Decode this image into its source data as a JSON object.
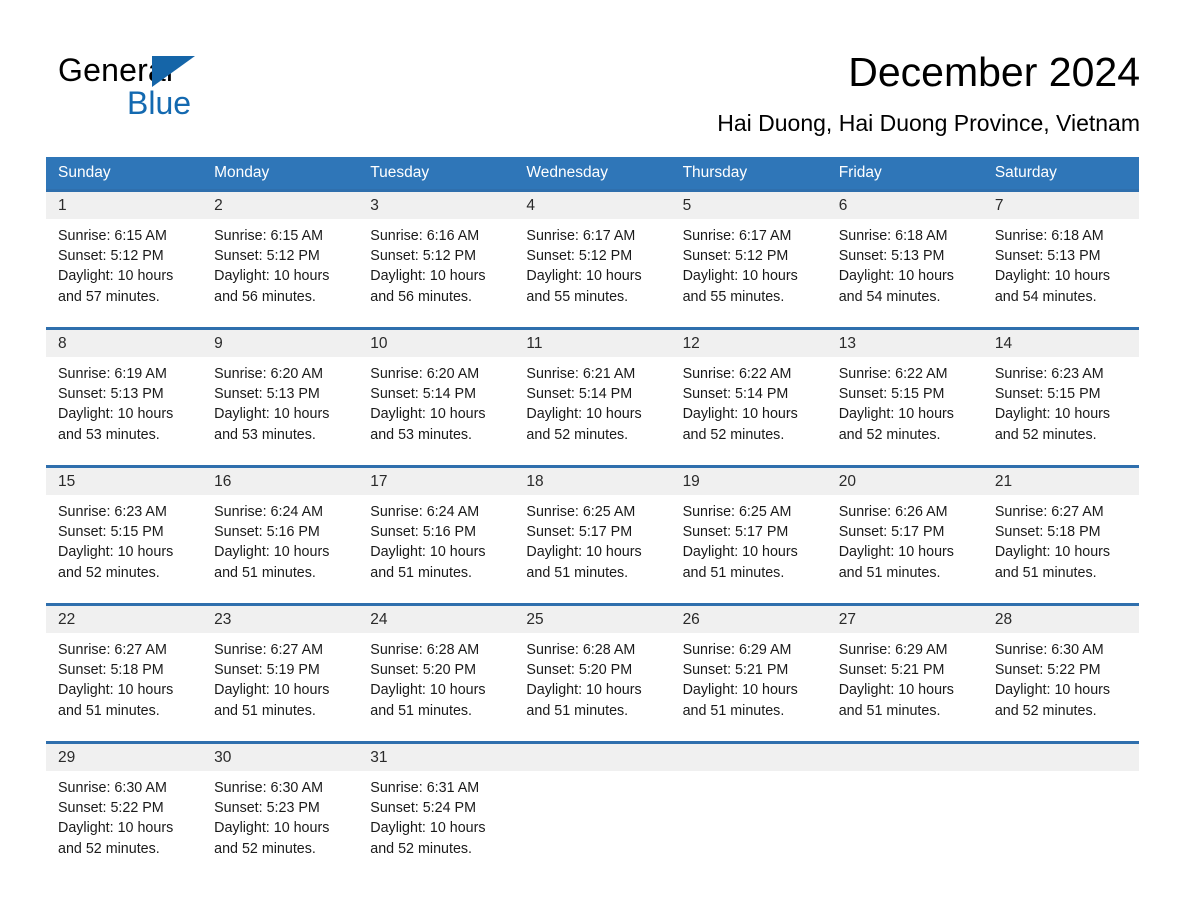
{
  "brand": {
    "name_part1": "General",
    "name_part2": "Blue",
    "accent_color": "#1369b0",
    "triangle_color": "#1565a8"
  },
  "header": {
    "title": "December 2024",
    "subtitle": "Hai Duong, Hai Duong Province, Vietnam"
  },
  "calendar": {
    "header_color": "#2f76b8",
    "row_divider_color": "#2f6fad",
    "daynum_band_color": "#f0f0f0",
    "weekdays": [
      "Sunday",
      "Monday",
      "Tuesday",
      "Wednesday",
      "Thursday",
      "Friday",
      "Saturday"
    ],
    "weeks": [
      [
        {
          "day": "1",
          "sunrise": "Sunrise: 6:15 AM",
          "sunset": "Sunset: 5:12 PM",
          "daylight1": "Daylight: 10 hours",
          "daylight2": "and 57 minutes."
        },
        {
          "day": "2",
          "sunrise": "Sunrise: 6:15 AM",
          "sunset": "Sunset: 5:12 PM",
          "daylight1": "Daylight: 10 hours",
          "daylight2": "and 56 minutes."
        },
        {
          "day": "3",
          "sunrise": "Sunrise: 6:16 AM",
          "sunset": "Sunset: 5:12 PM",
          "daylight1": "Daylight: 10 hours",
          "daylight2": "and 56 minutes."
        },
        {
          "day": "4",
          "sunrise": "Sunrise: 6:17 AM",
          "sunset": "Sunset: 5:12 PM",
          "daylight1": "Daylight: 10 hours",
          "daylight2": "and 55 minutes."
        },
        {
          "day": "5",
          "sunrise": "Sunrise: 6:17 AM",
          "sunset": "Sunset: 5:12 PM",
          "daylight1": "Daylight: 10 hours",
          "daylight2": "and 55 minutes."
        },
        {
          "day": "6",
          "sunrise": "Sunrise: 6:18 AM",
          "sunset": "Sunset: 5:13 PM",
          "daylight1": "Daylight: 10 hours",
          "daylight2": "and 54 minutes."
        },
        {
          "day": "7",
          "sunrise": "Sunrise: 6:18 AM",
          "sunset": "Sunset: 5:13 PM",
          "daylight1": "Daylight: 10 hours",
          "daylight2": "and 54 minutes."
        }
      ],
      [
        {
          "day": "8",
          "sunrise": "Sunrise: 6:19 AM",
          "sunset": "Sunset: 5:13 PM",
          "daylight1": "Daylight: 10 hours",
          "daylight2": "and 53 minutes."
        },
        {
          "day": "9",
          "sunrise": "Sunrise: 6:20 AM",
          "sunset": "Sunset: 5:13 PM",
          "daylight1": "Daylight: 10 hours",
          "daylight2": "and 53 minutes."
        },
        {
          "day": "10",
          "sunrise": "Sunrise: 6:20 AM",
          "sunset": "Sunset: 5:14 PM",
          "daylight1": "Daylight: 10 hours",
          "daylight2": "and 53 minutes."
        },
        {
          "day": "11",
          "sunrise": "Sunrise: 6:21 AM",
          "sunset": "Sunset: 5:14 PM",
          "daylight1": "Daylight: 10 hours",
          "daylight2": "and 52 minutes."
        },
        {
          "day": "12",
          "sunrise": "Sunrise: 6:22 AM",
          "sunset": "Sunset: 5:14 PM",
          "daylight1": "Daylight: 10 hours",
          "daylight2": "and 52 minutes."
        },
        {
          "day": "13",
          "sunrise": "Sunrise: 6:22 AM",
          "sunset": "Sunset: 5:15 PM",
          "daylight1": "Daylight: 10 hours",
          "daylight2": "and 52 minutes."
        },
        {
          "day": "14",
          "sunrise": "Sunrise: 6:23 AM",
          "sunset": "Sunset: 5:15 PM",
          "daylight1": "Daylight: 10 hours",
          "daylight2": "and 52 minutes."
        }
      ],
      [
        {
          "day": "15",
          "sunrise": "Sunrise: 6:23 AM",
          "sunset": "Sunset: 5:15 PM",
          "daylight1": "Daylight: 10 hours",
          "daylight2": "and 52 minutes."
        },
        {
          "day": "16",
          "sunrise": "Sunrise: 6:24 AM",
          "sunset": "Sunset: 5:16 PM",
          "daylight1": "Daylight: 10 hours",
          "daylight2": "and 51 minutes."
        },
        {
          "day": "17",
          "sunrise": "Sunrise: 6:24 AM",
          "sunset": "Sunset: 5:16 PM",
          "daylight1": "Daylight: 10 hours",
          "daylight2": "and 51 minutes."
        },
        {
          "day": "18",
          "sunrise": "Sunrise: 6:25 AM",
          "sunset": "Sunset: 5:17 PM",
          "daylight1": "Daylight: 10 hours",
          "daylight2": "and 51 minutes."
        },
        {
          "day": "19",
          "sunrise": "Sunrise: 6:25 AM",
          "sunset": "Sunset: 5:17 PM",
          "daylight1": "Daylight: 10 hours",
          "daylight2": "and 51 minutes."
        },
        {
          "day": "20",
          "sunrise": "Sunrise: 6:26 AM",
          "sunset": "Sunset: 5:17 PM",
          "daylight1": "Daylight: 10 hours",
          "daylight2": "and 51 minutes."
        },
        {
          "day": "21",
          "sunrise": "Sunrise: 6:27 AM",
          "sunset": "Sunset: 5:18 PM",
          "daylight1": "Daylight: 10 hours",
          "daylight2": "and 51 minutes."
        }
      ],
      [
        {
          "day": "22",
          "sunrise": "Sunrise: 6:27 AM",
          "sunset": "Sunset: 5:18 PM",
          "daylight1": "Daylight: 10 hours",
          "daylight2": "and 51 minutes."
        },
        {
          "day": "23",
          "sunrise": "Sunrise: 6:27 AM",
          "sunset": "Sunset: 5:19 PM",
          "daylight1": "Daylight: 10 hours",
          "daylight2": "and 51 minutes."
        },
        {
          "day": "24",
          "sunrise": "Sunrise: 6:28 AM",
          "sunset": "Sunset: 5:20 PM",
          "daylight1": "Daylight: 10 hours",
          "daylight2": "and 51 minutes."
        },
        {
          "day": "25",
          "sunrise": "Sunrise: 6:28 AM",
          "sunset": "Sunset: 5:20 PM",
          "daylight1": "Daylight: 10 hours",
          "daylight2": "and 51 minutes."
        },
        {
          "day": "26",
          "sunrise": "Sunrise: 6:29 AM",
          "sunset": "Sunset: 5:21 PM",
          "daylight1": "Daylight: 10 hours",
          "daylight2": "and 51 minutes."
        },
        {
          "day": "27",
          "sunrise": "Sunrise: 6:29 AM",
          "sunset": "Sunset: 5:21 PM",
          "daylight1": "Daylight: 10 hours",
          "daylight2": "and 51 minutes."
        },
        {
          "day": "28",
          "sunrise": "Sunrise: 6:30 AM",
          "sunset": "Sunset: 5:22 PM",
          "daylight1": "Daylight: 10 hours",
          "daylight2": "and 52 minutes."
        }
      ],
      [
        {
          "day": "29",
          "sunrise": "Sunrise: 6:30 AM",
          "sunset": "Sunset: 5:22 PM",
          "daylight1": "Daylight: 10 hours",
          "daylight2": "and 52 minutes."
        },
        {
          "day": "30",
          "sunrise": "Sunrise: 6:30 AM",
          "sunset": "Sunset: 5:23 PM",
          "daylight1": "Daylight: 10 hours",
          "daylight2": "and 52 minutes."
        },
        {
          "day": "31",
          "sunrise": "Sunrise: 6:31 AM",
          "sunset": "Sunset: 5:24 PM",
          "daylight1": "Daylight: 10 hours",
          "daylight2": "and 52 minutes."
        },
        {
          "day": "",
          "sunrise": "",
          "sunset": "",
          "daylight1": "",
          "daylight2": ""
        },
        {
          "day": "",
          "sunrise": "",
          "sunset": "",
          "daylight1": "",
          "daylight2": ""
        },
        {
          "day": "",
          "sunrise": "",
          "sunset": "",
          "daylight1": "",
          "daylight2": ""
        },
        {
          "day": "",
          "sunrise": "",
          "sunset": "",
          "daylight1": "",
          "daylight2": ""
        }
      ]
    ]
  }
}
